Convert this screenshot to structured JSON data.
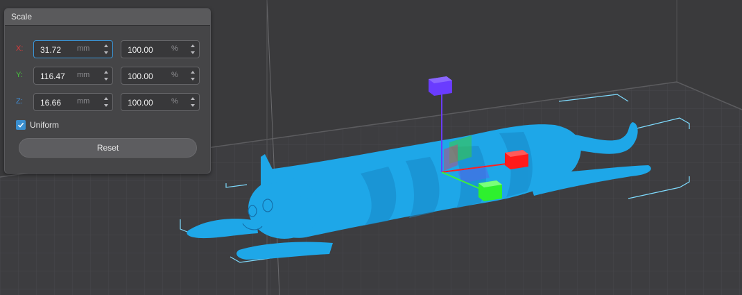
{
  "panel": {
    "title": "Scale",
    "rows": [
      {
        "axis": "X:",
        "color": "#e03a3a",
        "mm_value": "31.72",
        "mm_unit": "mm",
        "pct_value": "100.00",
        "pct_unit": "%"
      },
      {
        "axis": "Y:",
        "color": "#46c43c",
        "mm_value": "116.47",
        "mm_unit": "mm",
        "pct_value": "100.00",
        "pct_unit": "%"
      },
      {
        "axis": "Z:",
        "color": "#3f8fd8",
        "mm_value": "16.66",
        "mm_unit": "mm",
        "pct_value": "100.00",
        "pct_unit": "%"
      }
    ],
    "uniform_label": "Uniform",
    "uniform_checked": true,
    "reset_label": "Reset"
  },
  "colors": {
    "model": "#1ea7e8",
    "gizmo_x": "#ff2020",
    "gizmo_y": "#3cf03c",
    "gizmo_z": "#6a3cff",
    "bounding_box": "#7fdcff",
    "accent": "#3a95d6"
  },
  "icons": {
    "checkbox": "checkmark-icon",
    "spin_up": "chevron-up-icon",
    "spin_down": "chevron-down-icon"
  }
}
